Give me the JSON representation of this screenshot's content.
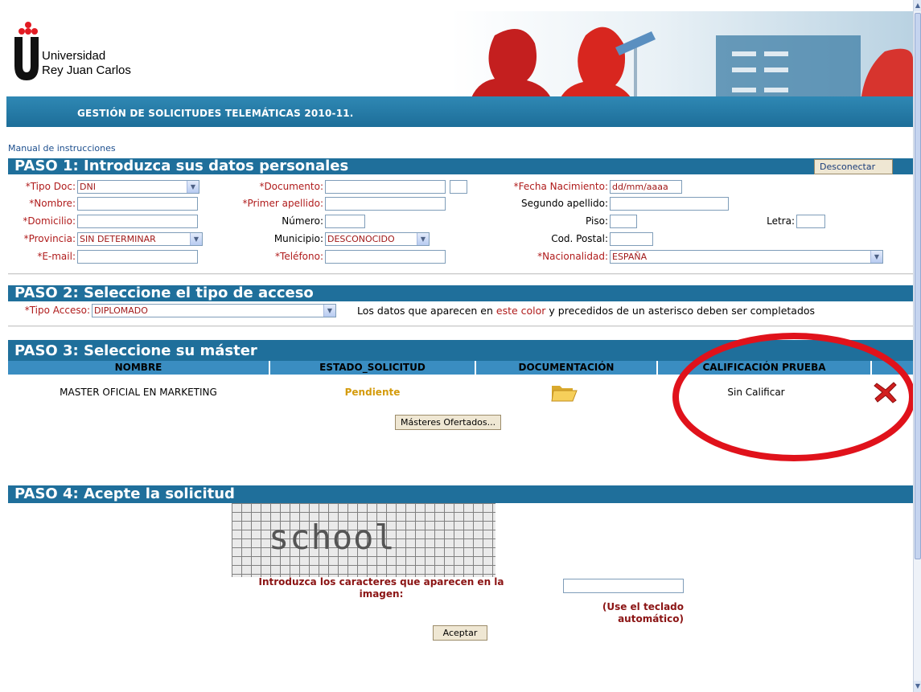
{
  "university": {
    "line1": "Universidad",
    "line2": "Rey Juan Carlos"
  },
  "header": {
    "title": "GESTIÓN DE SOLICITUDES TELEMÁTICAS 2010-11."
  },
  "links": {
    "manual": "Manual de instrucciones"
  },
  "paso1": {
    "title": "PASO 1: Introduzca sus datos personales",
    "disconnect": "Desconectar",
    "tipo_doc": {
      "label": "*Tipo Doc:",
      "value": "DNI"
    },
    "documento": {
      "label": "*Documento:",
      "value": ""
    },
    "fecha": {
      "label": "*Fecha Nacimiento:",
      "value": "dd/mm/aaaa"
    },
    "nombre": {
      "label": "*Nombre:",
      "value": ""
    },
    "primer_apellido": {
      "label": "*Primer apellido:",
      "value": ""
    },
    "segundo_apellido": {
      "label": "Segundo apellido:",
      "value": ""
    },
    "domicilio": {
      "label": "*Domicilio:",
      "value": ""
    },
    "numero": {
      "label": "Número:",
      "value": ""
    },
    "piso": {
      "label": "Piso:",
      "value": ""
    },
    "letra": {
      "label": "Letra:",
      "value": ""
    },
    "provincia": {
      "label": "*Provincia:",
      "value": "SIN DETERMINAR"
    },
    "municipio": {
      "label": "Municipio:",
      "value": "DESCONOCIDO"
    },
    "cod_postal": {
      "label": "Cod. Postal:",
      "value": ""
    },
    "email": {
      "label": "*E-mail:",
      "value": ""
    },
    "telefono": {
      "label": "*Teléfono:",
      "value": ""
    },
    "nacionalidad": {
      "label": "*Nacionalidad:",
      "value": "ESPAÑA"
    }
  },
  "paso2": {
    "title": "PASO 2: Seleccione el tipo de acceso",
    "tipo_acceso": {
      "label": "*Tipo Acceso:",
      "value": "DIPLOMADO"
    },
    "note_pre": "Los datos que aparecen en ",
    "note_color": "este color",
    "note_post": " y precedidos de un asterisco deben ser completados"
  },
  "paso3": {
    "title": "PASO 3: Seleccione su máster",
    "columns": [
      "NOMBRE",
      "ESTADO_SOLICITUD",
      "DOCUMENTACIÓN",
      "CALIFICACIÓN PRUEBA"
    ],
    "row": {
      "nombre": "MASTER OFICIAL EN MARKETING",
      "estado": "Pendiente",
      "calificacion": "Sin Calificar"
    },
    "masters_button": "Másteres Ofertados..."
  },
  "paso4": {
    "title": "PASO 4: Acepte la solicitud",
    "captcha_word": "school",
    "captcha_prompt": "Introduzca los caracteres que aparecen en la imagen:",
    "keyboard_hint": "(Use el teclado automático)",
    "accept": "Aceptar"
  },
  "colors": {
    "section_bar": "#1f6f9b",
    "required": "#b01c1c",
    "highlight_ring": "#e0121b"
  }
}
